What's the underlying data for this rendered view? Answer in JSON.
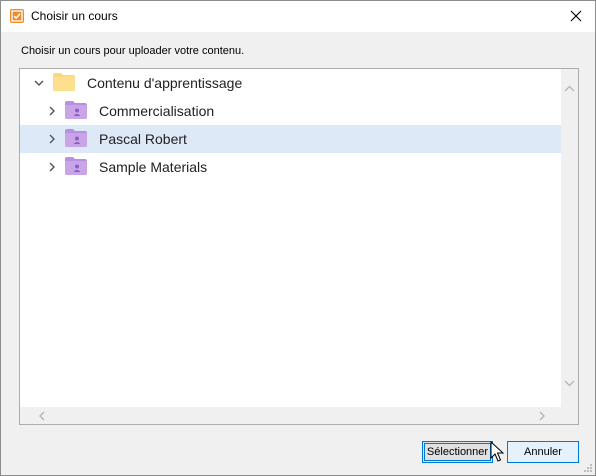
{
  "window": {
    "title": "Choisir un cours",
    "app_icon": "checkbox-icon",
    "close_icon": "close-icon"
  },
  "instruction": "Choisir un cours pour uploader votre contenu.",
  "tree": {
    "root": {
      "label": "Contenu d'apprentissage",
      "icon": "folder-icon",
      "expanded": true
    },
    "items": [
      {
        "label": "Commercialisation",
        "icon": "user-folder-icon",
        "selected": false
      },
      {
        "label": "Pascal Robert",
        "icon": "user-folder-icon",
        "selected": true
      },
      {
        "label": "Sample Materials",
        "icon": "user-folder-icon",
        "selected": false
      }
    ]
  },
  "buttons": {
    "select": "Sélectionner",
    "cancel": "Annuler"
  },
  "colors": {
    "accent": "#0078d7",
    "selection": "#dde9f6",
    "app_icon": "#f08b2c",
    "folder_root": "#fbd97c",
    "folder_user": "#c9a5e8"
  }
}
